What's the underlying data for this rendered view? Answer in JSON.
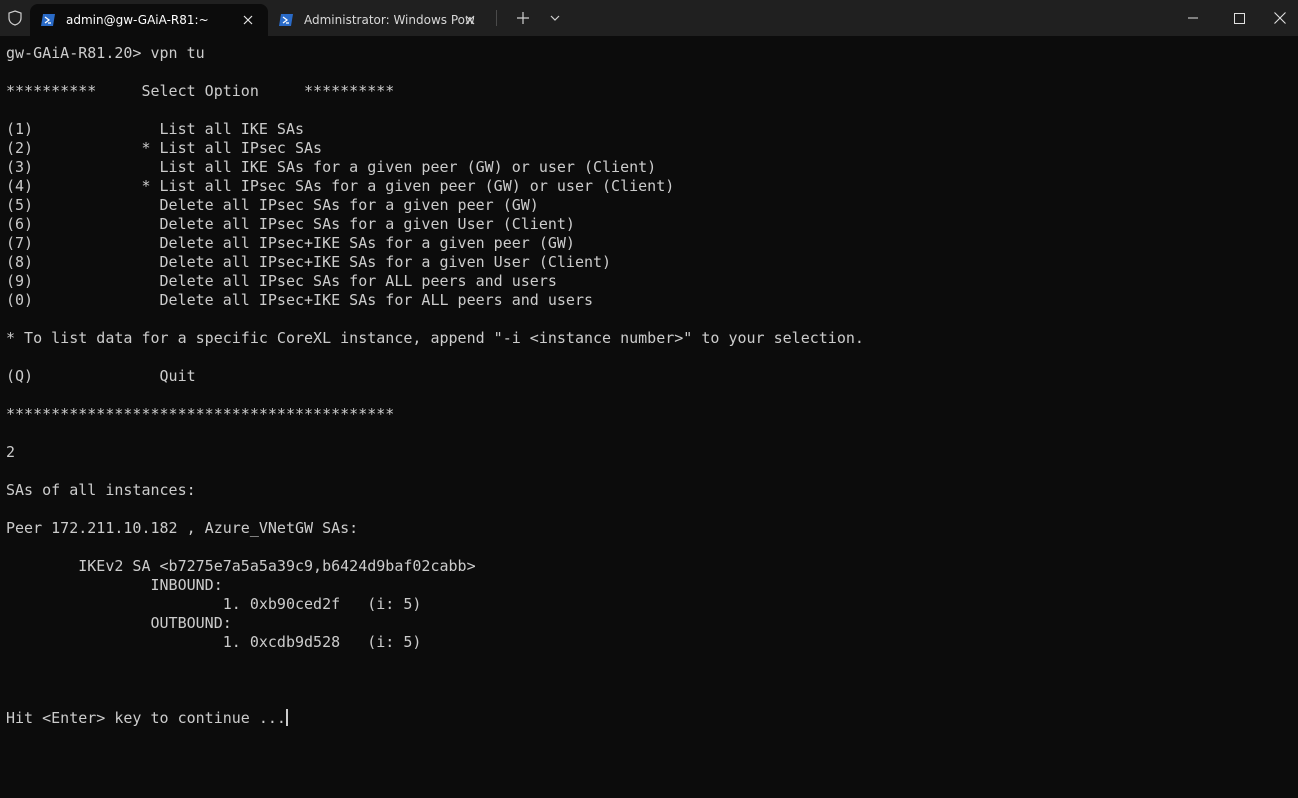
{
  "window": {
    "tabs": [
      {
        "label": "admin@gw-GAiA-R81:~",
        "active": true,
        "icon": "powershell-icon"
      },
      {
        "label": "Administrator: Windows PowerShell",
        "active": false,
        "icon": "powershell-icon"
      }
    ],
    "new_tab_symbol": "+",
    "controls": [
      "minimize",
      "maximize",
      "close"
    ]
  },
  "terminal": {
    "lines": [
      "gw-GAiA-R81.20> vpn tu",
      "",
      "**********     Select Option     **********",
      "",
      "(1)              List all IKE SAs",
      "(2)            * List all IPsec SAs",
      "(3)              List all IKE SAs for a given peer (GW) or user (Client)",
      "(4)            * List all IPsec SAs for a given peer (GW) or user (Client)",
      "(5)              Delete all IPsec SAs for a given peer (GW)",
      "(6)              Delete all IPsec SAs for a given User (Client)",
      "(7)              Delete all IPsec+IKE SAs for a given peer (GW)",
      "(8)              Delete all IPsec+IKE SAs for a given User (Client)",
      "(9)              Delete all IPsec SAs for ALL peers and users",
      "(0)              Delete all IPsec+IKE SAs for ALL peers and users",
      "",
      "* To list data for a specific CoreXL instance, append \"-i <instance number>\" to your selection.",
      "",
      "(Q)              Quit",
      "",
      "*******************************************",
      "",
      "2",
      "",
      "SAs of all instances:",
      "",
      "Peer 172.211.10.182 , Azure_VNetGW SAs:",
      "",
      "        IKEv2 SA <b7275e7a5a5a39c9,b6424d9baf02cabb>",
      "                INBOUND:",
      "                        1. 0xb90ced2f   (i: 5)",
      "                OUTBOUND:",
      "                        1. 0xcdb9d528   (i: 5)",
      "",
      "",
      "",
      "Hit <Enter> key to continue ..."
    ]
  }
}
